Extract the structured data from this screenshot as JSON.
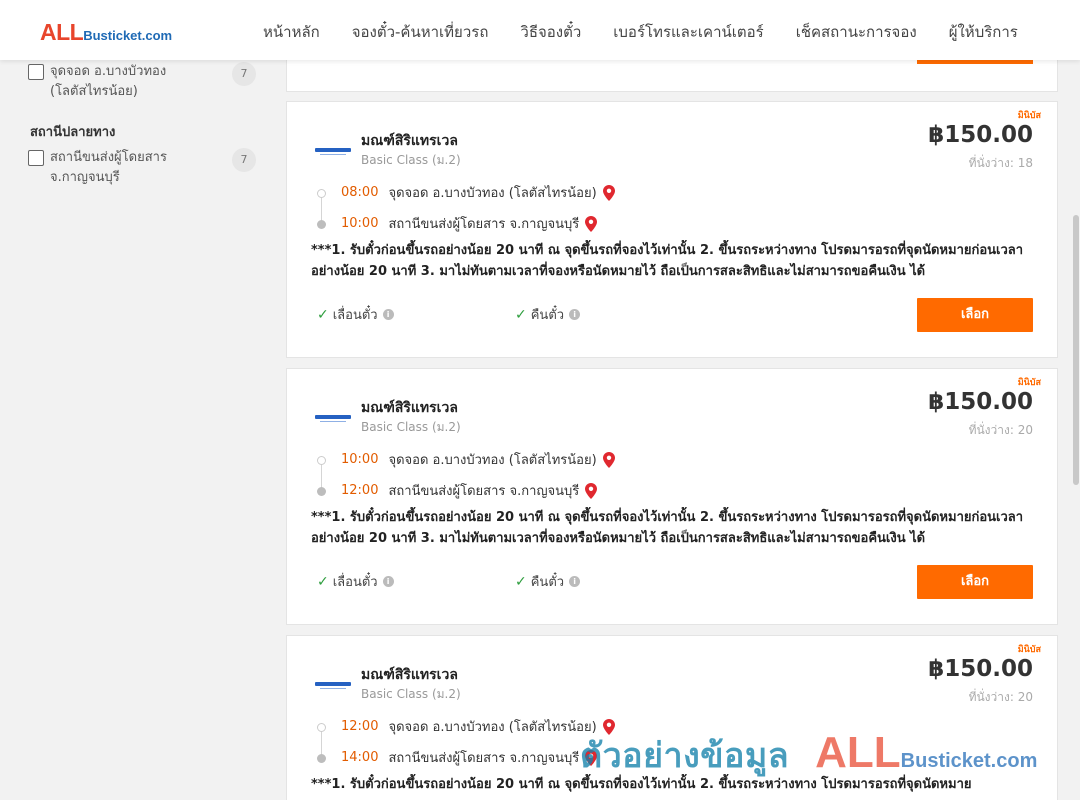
{
  "header": {
    "logo_all": "ALL",
    "logo_rest": "Busticket.com",
    "nav": [
      "หน้าหลัก",
      "จองตั๋ว-ค้นหาเที่ยวรถ",
      "วิธีจองตั๋ว",
      "เบอร์โทรและเคาน์เตอร์",
      "เช็คสถานะการจอง",
      "ผู้ให้บริการ"
    ]
  },
  "sidebar": {
    "origin_filter": {
      "label": "จุดจอด อ.บางบัวทอง (โลตัสไทรน้อย)",
      "count": "7"
    },
    "destination_title": "สถานีปลายทาง",
    "destination_filter": {
      "label": "สถานีขนส่งผู้โดยสาร จ.กาญจนบุรี",
      "count": "7"
    }
  },
  "trips": [
    {
      "type": "มินิบัส",
      "operator": "มณฑ์สิริแทรเวล",
      "class": "Basic Class (ม.2)",
      "price": "฿150.00",
      "seats": "ที่นั่งว่าง: 18",
      "depart_time": "08:00",
      "depart_place": "จุดจอด อ.บางบัวทอง (โลตัสไทรน้อย)",
      "arrive_time": "10:00",
      "arrive_place": "สถานีขนส่งผู้โดยสาร จ.กาญจนบุรี",
      "note": "***1. รับตั๋วก่อนขึ้นรถอย่างน้อย 20 นาที ณ จุดขึ้นรถที่จองไว้เท่านั้น 2. ขึ้นรถระหว่างทาง โปรดมารอรถที่จุดนัดหมายก่อนเวลาอย่างน้อย 20 นาที 3. มาไม่ทันตามเวลาที่จองหรือนัดหมายไว้ ถือเป็นการสละสิทธิและไม่สามารถขอคืนเงิน ได้",
      "feature1": "เลื่อนตั๋ว",
      "feature2": "คืนตั๋ว",
      "button": "เลือก"
    },
    {
      "type": "มินิบัส",
      "operator": "มณฑ์สิริแทรเวล",
      "class": "Basic Class (ม.2)",
      "price": "฿150.00",
      "seats": "ที่นั่งว่าง: 20",
      "depart_time": "10:00",
      "depart_place": "จุดจอด อ.บางบัวทอง (โลตัสไทรน้อย)",
      "arrive_time": "12:00",
      "arrive_place": "สถานีขนส่งผู้โดยสาร จ.กาญจนบุรี",
      "note": "***1. รับตั๋วก่อนขึ้นรถอย่างน้อย 20 นาที ณ จุดขึ้นรถที่จองไว้เท่านั้น 2. ขึ้นรถระหว่างทาง โปรดมารอรถที่จุดนัดหมายก่อนเวลาอย่างน้อย 20 นาที 3. มาไม่ทันตามเวลาที่จองหรือนัดหมายไว้ ถือเป็นการสละสิทธิและไม่สามารถขอคืนเงิน ได้",
      "feature1": "เลื่อนตั๋ว",
      "feature2": "คืนตั๋ว",
      "button": "เลือก"
    },
    {
      "type": "มินิบัส",
      "operator": "มณฑ์สิริแทรเวล",
      "class": "Basic Class (ม.2)",
      "price": "฿150.00",
      "seats": "ที่นั่งว่าง: 20",
      "depart_time": "12:00",
      "depart_place": "จุดจอด อ.บางบัวทอง (โลตัสไทรน้อย)",
      "arrive_time": "14:00",
      "arrive_place": "สถานีขนส่งผู้โดยสาร จ.กาญจนบุรี",
      "note": "***1. รับตั๋วก่อนขึ้นรถอย่างน้อย 20 นาที ณ จุดขึ้นรถที่จองไว้เท่านั้น 2. ขึ้นรถระหว่างทาง โปรดมารอรถที่จุดนัดหมาย"
    }
  ],
  "watermark": {
    "thai": "ตัวอย่างข้อมูล",
    "all": "ALL",
    "rest": "Busticket.com"
  },
  "colors": {
    "accent": "#ff6a00",
    "time": "#e25c00",
    "brand_red": "#e8452c",
    "brand_blue": "#1f6ab5"
  }
}
